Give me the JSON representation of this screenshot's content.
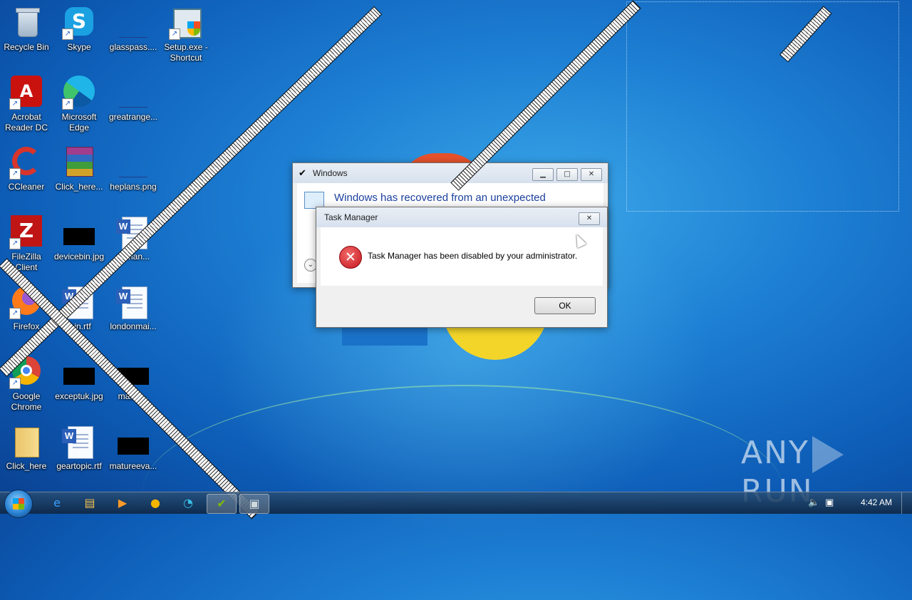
{
  "desktop": {
    "icons": [
      {
        "label": "Recycle Bin"
      },
      {
        "label": "Skype"
      },
      {
        "label": "glasspass...."
      },
      {
        "label": "Setup.exe -\nShortcut"
      },
      {
        "label": "Acrobat\nReader DC"
      },
      {
        "label": "Microsoft\nEdge"
      },
      {
        "label": "greatrange..."
      },
      {
        "label": "CCleaner"
      },
      {
        "label": "Click_here..."
      },
      {
        "label": "heplans.png"
      },
      {
        "label": "FileZilla\nClient"
      },
      {
        "label": "devicebin.jpg"
      },
      {
        "label": "dsman..."
      },
      {
        "label": "Firefox"
      },
      {
        "label": "...in.rtf"
      },
      {
        "label": "londonmai..."
      },
      {
        "label": "Google\nChrome"
      },
      {
        "label": "exceptuk.jpg"
      },
      {
        "label": "maste..."
      },
      {
        "label": "Click_here"
      },
      {
        "label": "geartopic.rtf"
      },
      {
        "label": "matureeva..."
      }
    ]
  },
  "windows_dialog": {
    "title": "Windows",
    "message": "Windows has recovered from an unexpected"
  },
  "task_manager_dialog": {
    "title": "Task Manager",
    "message": "Task Manager has been disabled by your administrator.",
    "ok_label": "OK"
  },
  "watermark": {
    "left": "ANY",
    "right": "RUN"
  },
  "taskbar": {
    "clock": "4:42 AM",
    "pinned": [
      "ie-icon",
      "explorer-icon",
      "media-player-icon",
      "chrome-icon",
      "edge-icon",
      "windows-setup-icon",
      "dialog-window-icon"
    ]
  }
}
